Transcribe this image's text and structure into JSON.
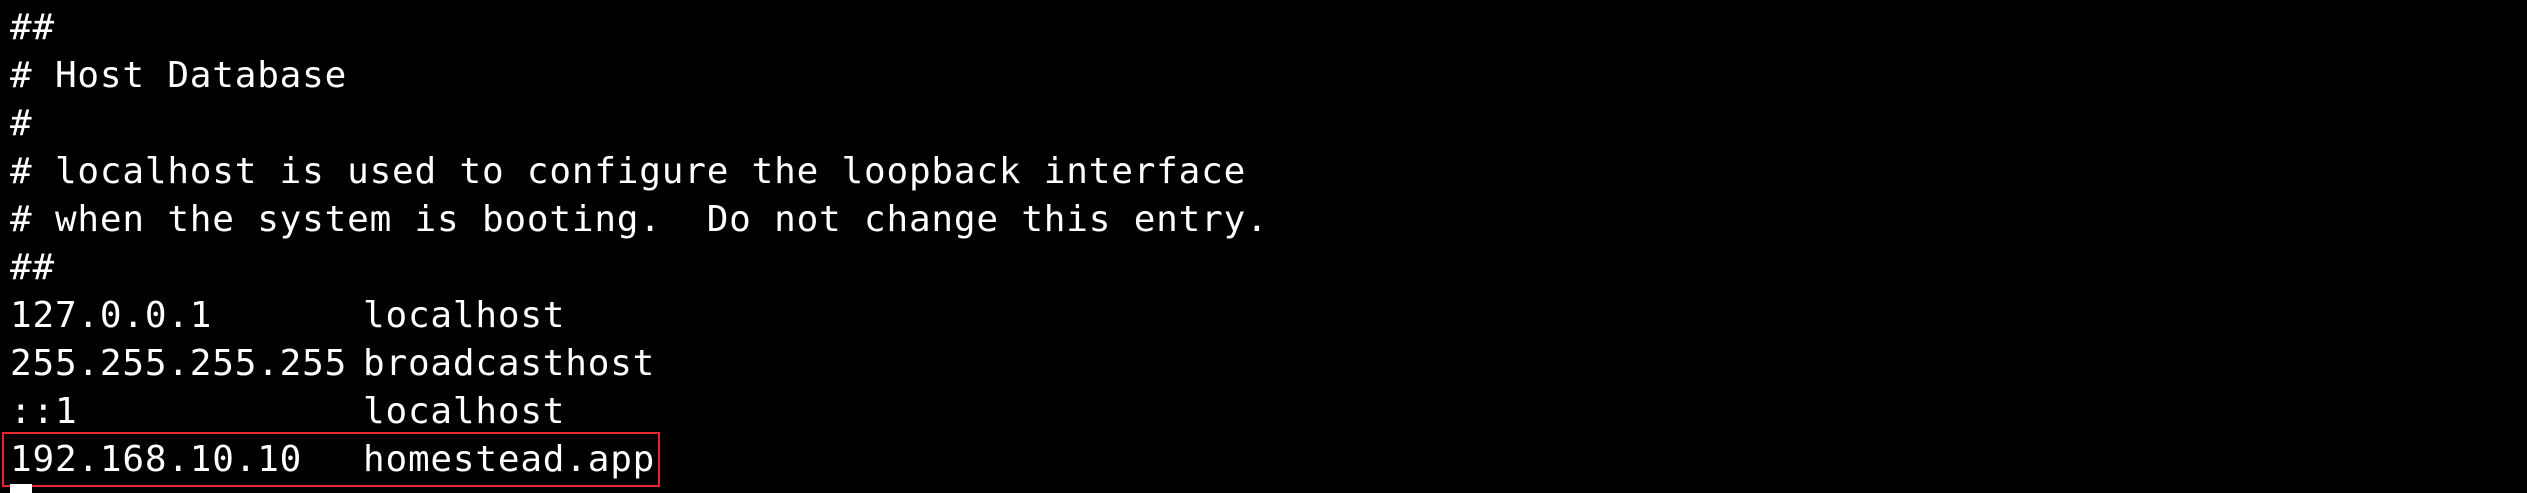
{
  "terminal": {
    "comments": [
      "##",
      "# Host Database",
      "#",
      "# localhost is used to configure the loopback interface",
      "# when the system is booting.  Do not change this entry.",
      "##"
    ],
    "entries": [
      {
        "ip": "127.0.0.1",
        "host": "localhost"
      },
      {
        "ip": "255.255.255.255",
        "host": "broadcasthost"
      },
      {
        "ip": "::1",
        "host": "localhost"
      },
      {
        "ip": "192.168.10.10",
        "host": "homestead.app"
      }
    ],
    "highlight_color": "#e8252b",
    "background_color": "#000000",
    "text_color": "#ffffff"
  }
}
